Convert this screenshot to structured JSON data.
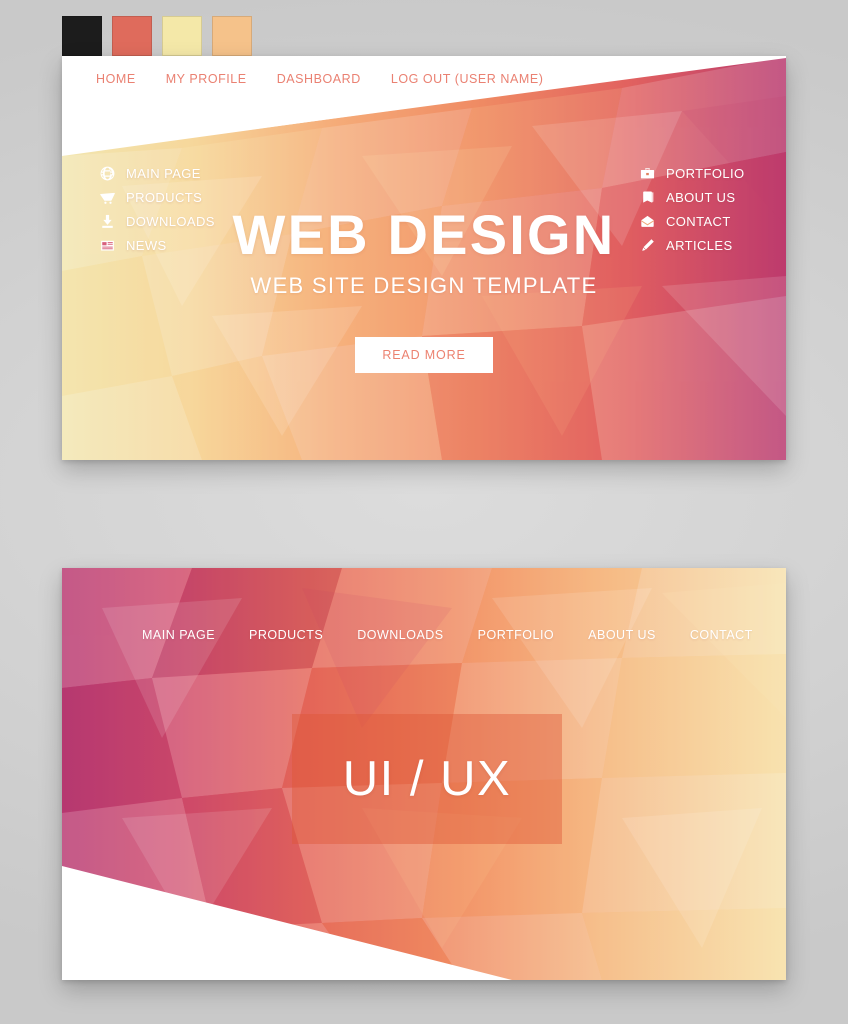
{
  "palette": {
    "swatches": [
      {
        "name": "swatch-black",
        "color": "#1c1c1c"
      },
      {
        "name": "swatch-salmon",
        "color": "#df6b5c"
      },
      {
        "name": "swatch-cream",
        "color": "#f4e8a8"
      },
      {
        "name": "swatch-peach",
        "color": "#f5c28a"
      }
    ],
    "page_background": "#d2d2d2",
    "nav_link_color": "#ea8172",
    "button_text_color": "#ec8270",
    "hero_gradient_from": "#f2e6b0",
    "hero_gradient_to": "#b8386e",
    "banner_gradient_from": "#b93a72",
    "banner_gradient_to": "#f7e2ae",
    "overlay_panel_color": "#de5634"
  },
  "card_one": {
    "nav": [
      {
        "label": "HOME"
      },
      {
        "label": "MY PROFILE"
      },
      {
        "label": "DASHBOARD"
      },
      {
        "label": "LOG OUT (USER NAME)"
      }
    ],
    "title": "WEB DESIGN",
    "subtitle": "WEB SITE DESIGN TEMPLATE",
    "cta_label": "READ MORE"
  },
  "card_two": {
    "nav": [
      {
        "label": "MAIN PAGE"
      },
      {
        "label": "PRODUCTS"
      },
      {
        "label": "DOWNLOADS"
      },
      {
        "label": "PORTFOLIO"
      },
      {
        "label": "ABOUT US"
      },
      {
        "label": "CONTACT"
      }
    ],
    "banner_text": "UI / UX",
    "menu_left": [
      {
        "label": "MAIN PAGE",
        "icon": "globe-icon"
      },
      {
        "label": "PRODUCTS",
        "icon": "shopping-cart-icon"
      },
      {
        "label": "DOWNLOADS",
        "icon": "download-icon"
      },
      {
        "label": "NEWS",
        "icon": "newspaper-icon"
      }
    ],
    "menu_right": [
      {
        "label": "PORTFOLIO",
        "icon": "briefcase-icon"
      },
      {
        "label": "ABOUT US",
        "icon": "book-icon"
      },
      {
        "label": "CONTACT",
        "icon": "envelope-icon"
      },
      {
        "label": "ARTICLES",
        "icon": "pencil-icon"
      }
    ]
  }
}
